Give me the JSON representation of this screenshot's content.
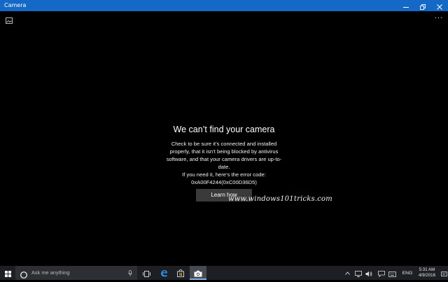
{
  "window": {
    "title": "Camera",
    "minimize_icon": "minimize-icon",
    "maximize_icon": "restore-icon",
    "close_icon": "close-icon",
    "accent": "#1469c7"
  },
  "appbar": {
    "gallery_icon": "photo-gallery-icon",
    "more_label": "···"
  },
  "error": {
    "heading": "We can’t find your camera",
    "body": "Check to be sure it’s connected and installed properly, that it isn’t being blocked by antivirus software, and that your camera drivers are up-to-date.",
    "code_intro": "If you need it, here’s the error code:",
    "code": "0xA00F4244(0xC00D36D5)",
    "button_label": "Learn how"
  },
  "watermark": "www.windows101tricks.com",
  "taskbar": {
    "search_placeholder": "Ask me anything",
    "language": "ENG",
    "time": "5:31 AM",
    "date": "4/9/2016",
    "tray_chevron": "^",
    "icons": [
      "windows-start-icon",
      "cortana-icon",
      "microphone-icon",
      "task-view-icon",
      "edge-icon",
      "store-icon",
      "camera-icon",
      "network-icon",
      "volume-icon",
      "message-icon",
      "keyboard-icon",
      "notification-icon"
    ]
  }
}
